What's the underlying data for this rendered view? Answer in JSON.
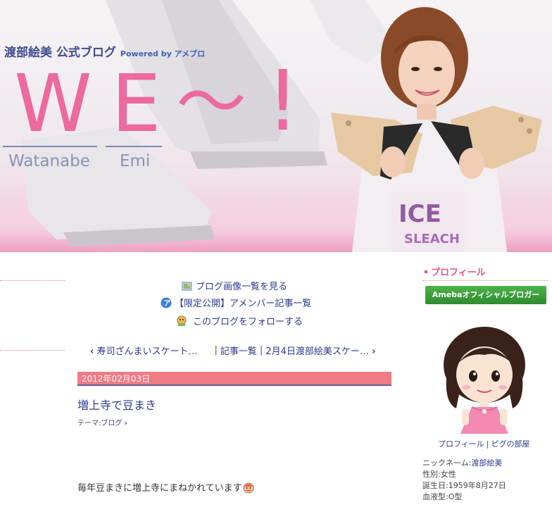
{
  "header": {
    "blog_title": "渡部絵美 公式ブログ",
    "powered_by": "Powered by アメブロ",
    "big_w": "W",
    "big_e": "E",
    "big_tilde": "〜",
    "big_bang": "!",
    "sub_watanabe": "Watanabe",
    "sub_emi": "Emi"
  },
  "main": {
    "menu": {
      "images_link": "ブログ画像一覧を見る",
      "member_link": "【限定公開】アメンバー記事一覧",
      "follow_link": "このブログをフォローする"
    },
    "pager": {
      "prev": "寿司ざんまいスケート…",
      "list": "記事一覧",
      "next": "2月4日渡部絵美スケー…"
    },
    "entry": {
      "date": "2012年02月03日",
      "title": "増上寺で豆まき",
      "theme_label": "テーマ:",
      "theme_value": "ブログ",
      "body": "毎年豆まきに増上寺にまねかれています"
    }
  },
  "sidebar": {
    "heading": "プロフィール",
    "badge": "Amebaオフィシャルブロガー",
    "links": {
      "profile": "プロフィール",
      "room": "ピグの部屋"
    },
    "details": {
      "nickname_label": "ニックネーム:",
      "nickname_value": "渡部絵美",
      "gender": "性別:女性",
      "birthday": "誕生日:1959年8月27日",
      "blood": "血液型:O型"
    }
  },
  "colors": {
    "accent_pink": "#ec6a9d",
    "date_bar": "#ef7b84",
    "link_blue": "#2b3a8a",
    "badge_green": "#3a9a3a"
  },
  "icons": [
    "image-list-icon",
    "ameba-member-icon",
    "follow-icon",
    "chevron-left-icon",
    "chevron-right-icon",
    "emoji-face-icon"
  ]
}
